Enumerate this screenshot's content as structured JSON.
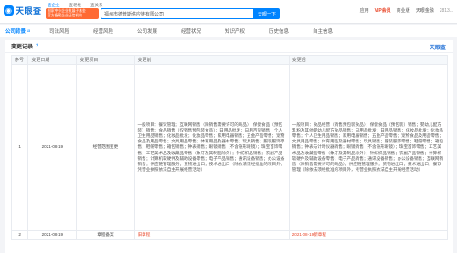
{
  "header": {
    "logo_text": "天眼查",
    "logo_tagline": "国家中小企业发展子基金旗下 官方备案企业征信机构",
    "top_tabs": [
      "查企业",
      "查老板",
      "查关系"
    ],
    "promo_line1": "国家中小企业发展子基金",
    "promo_line2": "官方备案企业征信机构",
    "search_value": "福州市德普斯供应链有限公司",
    "search_button": "天眼一下",
    "nav": {
      "app": "应用",
      "vip": "VIP会员",
      "biz": "商业版",
      "dept": "天眼金融",
      "me": "2813..."
    }
  },
  "company_tabs": [
    {
      "label": "公司背景",
      "badge": "13"
    },
    {
      "label": "司法风险",
      "badge": ""
    },
    {
      "label": "经营风险",
      "badge": ""
    },
    {
      "label": "公司发展",
      "badge": ""
    },
    {
      "label": "经营状况",
      "badge": ""
    },
    {
      "label": "知识产权",
      "badge": ""
    },
    {
      "label": "历史信息",
      "badge": ""
    },
    {
      "label": "自主信息",
      "badge": ""
    }
  ],
  "panel": {
    "title": "变更记录",
    "count": "2",
    "brand": "天眼查",
    "columns": [
      "序号",
      "变更日期",
      "变更项目",
      "变更前",
      "变更后"
    ],
    "rows": [
      {
        "index": "1",
        "date": "2021-08-19",
        "item": "经营范围变更",
        "before": "一般项目：餐饮管理；互联网销售（除销售需要许可的商品）；保健食品（预包装）销售；食品销售（仅销售预包装食品）；日用品批发；日用百货销售；个人卫生用品销售；化妆品批发；化妆品零售；家用电器销售；五金产品零售；宠物食品及用品零售；文具用品零售；体育用品及器材零售；玩具销售；服装服饰零售；鞋帽零售；箱包销售；钟表销售；眼镜销售（不含隐形眼镜）；珠宝首饰零售；工艺美术品及收藏品零售（象牙及其制品除外）；针纺织品销售；农副产品销售；计算机软硬件及辅助设备零售；电子产品销售；通讯设备销售；办公设备销售；供应链管理服务；货物进出口；技术进出口（除依法须经批准的项目外，凭营业执照依法自主开展经营活动）",
        "after": "一般项目：食品经营（销售预包装食品）；保健食品（预包装）销售；婴幼儿配方乳粉及其他婴幼儿配方食品销售；日用品批发；日用品销售；化妆品批发；化妆品零售；个人卫生用品销售；家用电器销售；五金产品零售；宠物食品及用品零售；文具用品零售；体育用品及器材零售；玩具销售；服装服饰零售；鞋帽零售；箱包销售；钟表与计时仪器销售；眼镜销售（不含隐形眼镜）；珠宝首饰零售；工艺美术品及收藏品零售（象牙及其制品除外）；针纺织品销售；农副产品销售；计算机软硬件及辅助设备零售；电子产品销售；通讯设备销售；办公设备销售；互联网销售（除销售需要许可的商品）；供应链管理服务；货物进出口；技术进出口；餐饮管理（除依法须经批准的项目外，凭营业执照依法自主开展经营活动）"
      },
      {
        "index": "2",
        "date": "2021-08-19",
        "item": "章程备案",
        "before": "旧章程",
        "after": "2021-08-19新章程"
      }
    ]
  }
}
